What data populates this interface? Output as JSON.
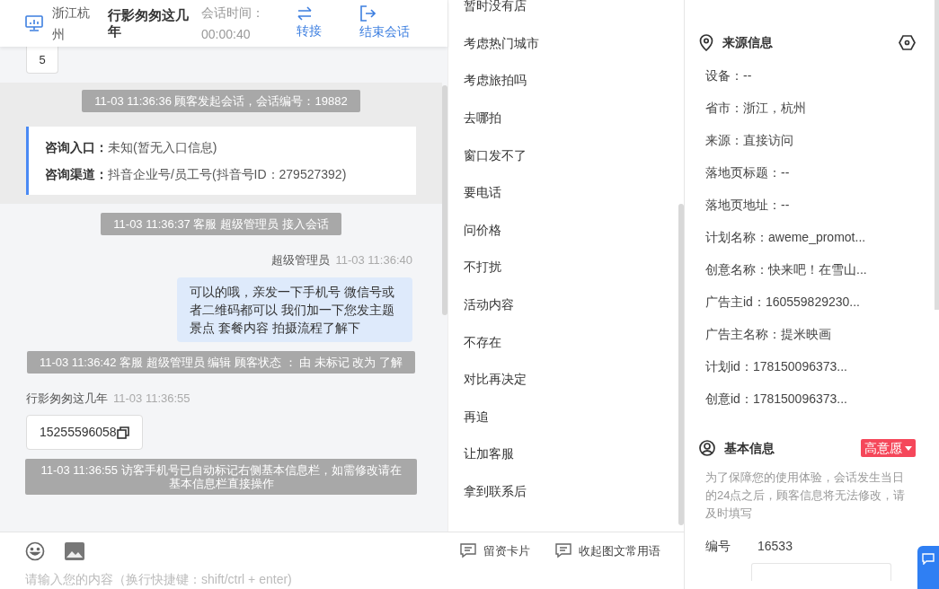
{
  "header": {
    "location": "浙江杭州",
    "customer_name": "行影匆匆这几年",
    "session_time_label": "会话时间：",
    "session_time": "00:00:40",
    "actions": [
      {
        "kind": "transfer",
        "label": "转接"
      },
      {
        "kind": "end",
        "label": "结束会话"
      }
    ]
  },
  "chat": {
    "partial_bubble": "5",
    "messages": [
      {
        "kind": "session_start",
        "text": "11-03 11:36:36 顾客发起会话，会话编号：19882"
      },
      {
        "kind": "info_card",
        "rows": [
          {
            "label": "咨询入口：",
            "value": "未知(暂无入口信息)"
          },
          {
            "label": "咨询渠道：",
            "value": "抖音企业号/员工号(抖音号ID：279527392)"
          }
        ]
      },
      {
        "kind": "system",
        "text": "11-03 11:36:37 客服 超级管理员 接入会话"
      },
      {
        "kind": "agent",
        "sender": "超级管理员",
        "time": "11-03 11:36:40",
        "text": "可以的哦，亲发一下手机号 微信号或者二维码都可以 我们加一下您发主题景点 套餐内容 拍摄流程了解下"
      },
      {
        "kind": "system",
        "text": "11-03 11:36:42 客服 超级管理员 编辑 顾客状态 ： 由 未标记 改为 了解"
      },
      {
        "kind": "customer",
        "sender": "行影匆匆这几年",
        "time": "11-03 11:36:55",
        "text": "15255596058"
      },
      {
        "kind": "system",
        "text": "11-03 11:36:55 访客手机号已自动标记右侧基本信息栏，如需修改请在基本信息栏直接操作"
      }
    ]
  },
  "quick_replies": [
    "暂时没有店",
    "考虑热门城市",
    "考虑旅拍吗",
    "去哪拍",
    "窗口发不了",
    "要电话",
    "问价格",
    "不打扰",
    "活动内容",
    "不存在",
    "对比再决定",
    "再追",
    "让加客服",
    "拿到联系后"
  ],
  "composer": {
    "placeholder": "请输入您的内容（换行快捷键：shift/ctrl + enter)",
    "tools": [
      "留资卡片",
      "收起图文常用语"
    ]
  },
  "source_info": {
    "title": "来源信息",
    "rows": [
      "设备：--",
      "省市：浙江，杭州",
      "来源：直接访问",
      "落地页标题：--",
      "落地页地址：--",
      "计划名称：aweme_promot...",
      "创意名称：快来吧！在雪山...",
      "广告主id：160559829230...",
      "广告主名称：提米映画",
      "计划id：178150096373...",
      "创意id：178150096373..."
    ]
  },
  "basic_info": {
    "title": "基本信息",
    "tag": "高意愿",
    "note": "为了保障您的使用体验，会话发生当日的24点之后，顾客信息将无法修改，请及时填写",
    "fields": [
      {
        "label": "编号",
        "value": "16533"
      }
    ]
  }
}
